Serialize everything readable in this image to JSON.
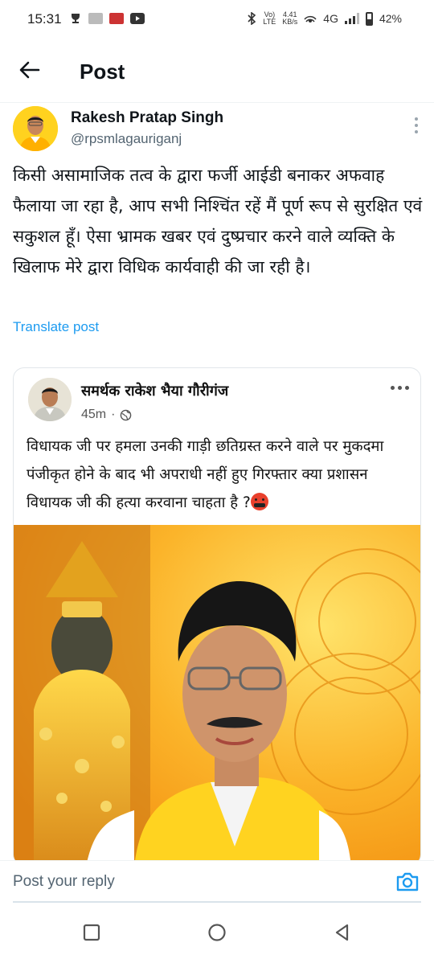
{
  "status_bar": {
    "time": "15:31",
    "speed_value": "4.41",
    "speed_unit": "KB/s",
    "volte_top": "Vo)",
    "volte_bottom": "LTE",
    "network": "4G",
    "battery": "42%"
  },
  "header": {
    "title": "Post",
    "back_icon": "arrow-left-icon"
  },
  "post": {
    "author_name": "Rakesh Pratap Singh",
    "author_handle": "@rpsmlagauriganj",
    "text": "किसी असामाजिक तत्व के द्वारा फर्जी आईडी बनाकर अफवाह  फैलाया जा रहा है, आप सभी निश्चिंत रहें मैं पूर्ण रूप से सुरक्षित एवं सकुशल हूँ। ऐसा भ्रामक खबर एवं दुष्प्रचार करने वाले व्यक्ति के खिलाफ मेरे द्वारा विधिक कार्यवाही की जा रही है।",
    "translate_label": "Translate post"
  },
  "quoted": {
    "name": "समर्थक राकेश भैया गौरीगंज",
    "time": "45m",
    "separator": "·",
    "text": "विधायक जी पर हमला उनकी गाड़ी छतिग्रस्त करने वाले पर मुकदमा पंजीकृत होने के बाद भी अपराधी नहीं हुए गिरफ्तार क्या प्रशासन विधायक जी की हत्या करवाना चाहता है ?"
  },
  "reply": {
    "placeholder": "Post your reply",
    "camera_icon": "camera-icon"
  },
  "colors": {
    "accent": "#1d9bf0",
    "card_bg_orange": "#f7a21b",
    "vest_yellow": "#ffd21f"
  }
}
